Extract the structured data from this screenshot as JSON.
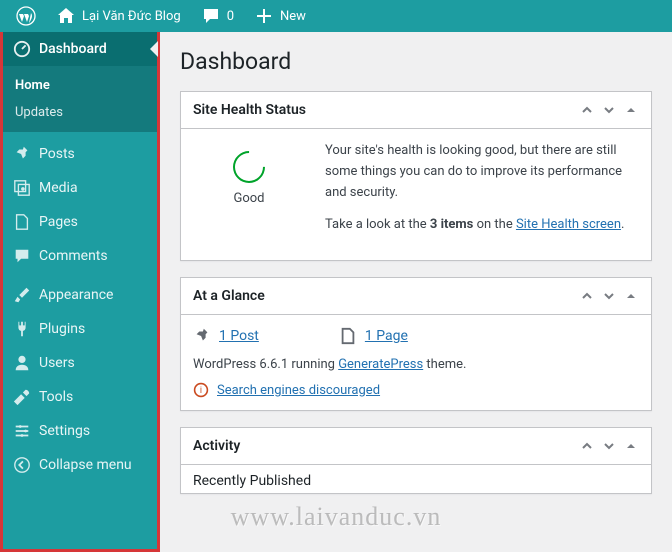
{
  "topbar": {
    "site_name": "Lại Văn Đức Blog",
    "comment_count": "0",
    "new_label": "New"
  },
  "sidebar": {
    "dashboard": "Dashboard",
    "home": "Home",
    "updates": "Updates",
    "posts": "Posts",
    "media": "Media",
    "pages": "Pages",
    "comments": "Comments",
    "appearance": "Appearance",
    "plugins": "Plugins",
    "users": "Users",
    "tools": "Tools",
    "settings": "Settings",
    "collapse": "Collapse menu"
  },
  "page": {
    "title": "Dashboard"
  },
  "health": {
    "title": "Site Health Status",
    "status": "Good",
    "desc": "Your site's health is looking good, but there are still some things you can do to improve its performance and security.",
    "cta_prefix": "Take a look at the ",
    "cta_bold": "3 items",
    "cta_mid": " on the ",
    "cta_link": "Site Health screen",
    "cta_suffix": "."
  },
  "glance": {
    "title": "At a Glance",
    "posts": "1 Post",
    "pages": "1 Page",
    "version_prefix": "WordPress 6.6.1 running ",
    "theme": "GeneratePress",
    "version_suffix": " theme.",
    "seo_notice": "Search engines discouraged"
  },
  "activity": {
    "title": "Activity",
    "recent": "Recently Published"
  },
  "watermark": "www.laivanduc.vn"
}
